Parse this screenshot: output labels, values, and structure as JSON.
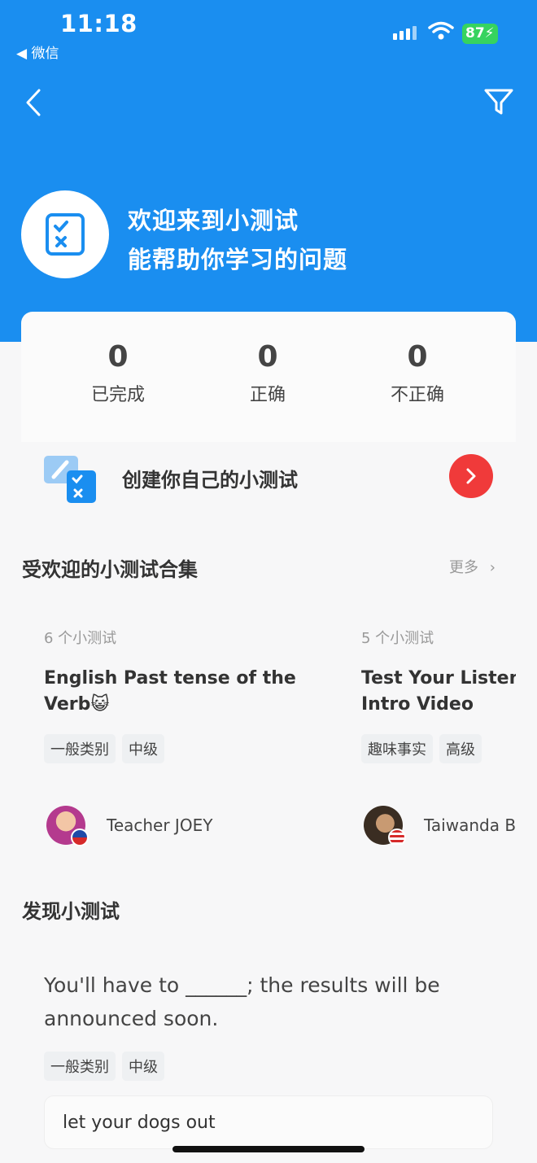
{
  "status_bar": {
    "time": "11:18",
    "back_app": "◀ 微信",
    "battery": "87"
  },
  "hero": {
    "title": "欢迎来到小测试",
    "subtitle": "能帮助你学习的问题"
  },
  "stats": [
    {
      "value": "0",
      "label": "已完成"
    },
    {
      "value": "0",
      "label": "正确"
    },
    {
      "value": "0",
      "label": "不正确"
    }
  ],
  "create": {
    "label": "创建你自己的小测试"
  },
  "popular": {
    "title": "受欢迎的小测试合集",
    "more": "更多",
    "collections": [
      {
        "count": "6 个小测试",
        "title_line1": "English Past tense of the",
        "title_line2": "Verb😺",
        "tags": [
          "一般类别",
          "中级"
        ],
        "author": "Teacher JOEY"
      },
      {
        "count": "5 个小测试",
        "title_line1": "Test Your Listeni",
        "title_line2": "Intro Video",
        "tags": [
          "趣味事实",
          "高级"
        ],
        "author": "Taiwanda Ba"
      }
    ]
  },
  "discover": {
    "title": "发现小测试",
    "question": "You'll have to ______; the results will be announced soon.",
    "tags": [
      "一般类别",
      "中级"
    ],
    "answer": "let your dogs out"
  },
  "colors": {
    "brand": "#1a8ef0",
    "accent": "#f03a3a"
  }
}
